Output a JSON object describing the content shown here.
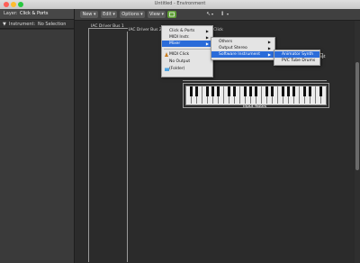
{
  "window": {
    "title": "Untitled - Environment"
  },
  "left_panel": {
    "layer_label": "Layer:",
    "layer_value": "Click & Ports",
    "inspector_label": "Instrument:",
    "inspector_value": "No Selection"
  },
  "toolbar": {
    "new": "New",
    "edit": "Edit",
    "options": "Options",
    "view": "View",
    "pointer_icon": "↖",
    "text_icon": "I"
  },
  "canvas": {
    "obj1": "IAC Driver Bus 1",
    "obj2": "IAC Driver Bus 2",
    "obj3": "Di Click",
    "obj4": "put",
    "keyboard_label": "Input Notes"
  },
  "menus": {
    "main": {
      "items": [
        "Click & Ports",
        "MIDI Instr.",
        "Mixer"
      ],
      "items2": [
        "MIDI Click",
        "No Output",
        "(Folder)"
      ]
    },
    "sub1": {
      "items": [
        "Others",
        "Output Stereo",
        "Software Instrument"
      ]
    },
    "sub2": {
      "items": [
        "Animator Synth",
        "PVC Tube Drums"
      ]
    }
  },
  "colors": {
    "selection": "#2b6cd9",
    "accent_green": "#5e9e35"
  }
}
